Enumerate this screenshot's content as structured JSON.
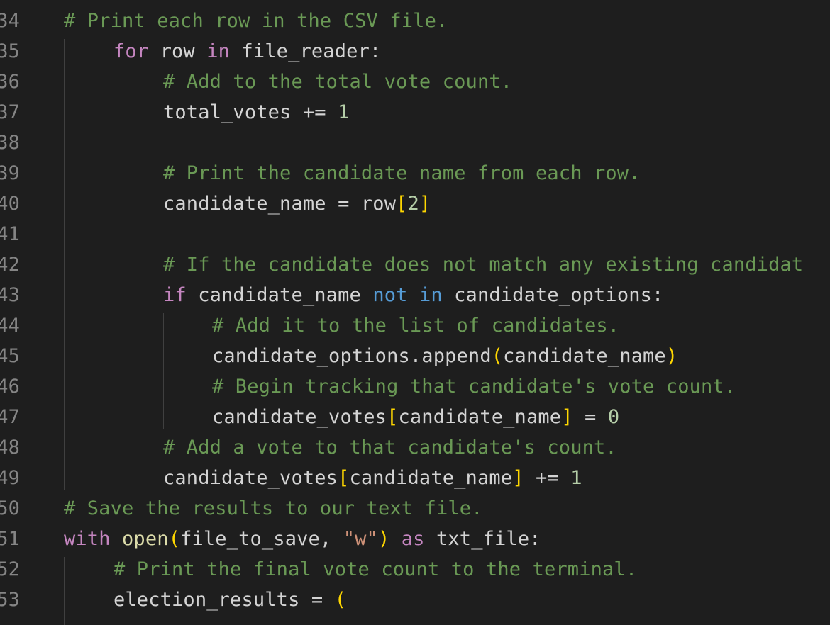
{
  "editor": {
    "language": "python",
    "theme_colors": {
      "background": "#1e1e1e",
      "line_number": "#858585",
      "keyword": "#c586c0",
      "operator_keyword": "#569cd6",
      "comment": "#6a9955",
      "number": "#b5cea8",
      "string": "#ce9178",
      "function": "#dcdcaa",
      "bracket": "#ffd700",
      "identifier": "#d4d4d4"
    },
    "lines": [
      {
        "number": "34",
        "indent": 1,
        "tokens": [
          {
            "t": "cm",
            "v": "# Print each row in the CSV file."
          }
        ]
      },
      {
        "number": "35",
        "indent": 2,
        "tokens": [
          {
            "t": "kw",
            "v": "for"
          },
          {
            "t": "id",
            "v": " row "
          },
          {
            "t": "kw",
            "v": "in"
          },
          {
            "t": "id",
            "v": " file_reader:"
          }
        ]
      },
      {
        "number": "36",
        "indent": 3,
        "tokens": [
          {
            "t": "cm",
            "v": "# Add to the total vote count."
          }
        ]
      },
      {
        "number": "37",
        "indent": 3,
        "tokens": [
          {
            "t": "id",
            "v": "total_votes += "
          },
          {
            "t": "num",
            "v": "1"
          }
        ]
      },
      {
        "number": "38",
        "indent": 3,
        "tokens": []
      },
      {
        "number": "39",
        "indent": 3,
        "tokens": [
          {
            "t": "cm",
            "v": "# Print the candidate name from each row."
          }
        ]
      },
      {
        "number": "40",
        "indent": 3,
        "tokens": [
          {
            "t": "id",
            "v": "candidate_name = row"
          },
          {
            "t": "br",
            "v": "["
          },
          {
            "t": "num",
            "v": "2"
          },
          {
            "t": "br",
            "v": "]"
          }
        ]
      },
      {
        "number": "41",
        "indent": 3,
        "tokens": []
      },
      {
        "number": "42",
        "indent": 3,
        "tokens": [
          {
            "t": "cm",
            "v": "# If the candidate does not match any existing candidat"
          }
        ]
      },
      {
        "number": "43",
        "indent": 3,
        "tokens": [
          {
            "t": "kw",
            "v": "if"
          },
          {
            "t": "id",
            "v": " candidate_name "
          },
          {
            "t": "op",
            "v": "not"
          },
          {
            "t": "id",
            "v": " "
          },
          {
            "t": "op",
            "v": "in"
          },
          {
            "t": "id",
            "v": " candidate_options:"
          }
        ]
      },
      {
        "number": "44",
        "indent": 4,
        "tokens": [
          {
            "t": "cm",
            "v": "# Add it to the list of candidates."
          }
        ]
      },
      {
        "number": "45",
        "indent": 4,
        "tokens": [
          {
            "t": "id",
            "v": "candidate_options.append"
          },
          {
            "t": "br",
            "v": "("
          },
          {
            "t": "id",
            "v": "candidate_name"
          },
          {
            "t": "br",
            "v": ")"
          }
        ]
      },
      {
        "number": "46",
        "indent": 4,
        "tokens": [
          {
            "t": "cm",
            "v": "# Begin tracking that candidate's vote count."
          }
        ]
      },
      {
        "number": "47",
        "indent": 4,
        "tokens": [
          {
            "t": "id",
            "v": "candidate_votes"
          },
          {
            "t": "br",
            "v": "["
          },
          {
            "t": "id",
            "v": "candidate_name"
          },
          {
            "t": "br",
            "v": "]"
          },
          {
            "t": "id",
            "v": " = "
          },
          {
            "t": "num",
            "v": "0"
          }
        ]
      },
      {
        "number": "48",
        "indent": 3,
        "tokens": [
          {
            "t": "cm",
            "v": "# Add a vote to that candidate's count."
          }
        ]
      },
      {
        "number": "49",
        "indent": 3,
        "tokens": [
          {
            "t": "id",
            "v": "candidate_votes"
          },
          {
            "t": "br",
            "v": "["
          },
          {
            "t": "id",
            "v": "candidate_name"
          },
          {
            "t": "br",
            "v": "]"
          },
          {
            "t": "id",
            "v": " += "
          },
          {
            "t": "num",
            "v": "1"
          }
        ]
      },
      {
        "number": "50",
        "indent": 1,
        "tokens": [
          {
            "t": "cm",
            "v": "# Save the results to our text file."
          }
        ]
      },
      {
        "number": "51",
        "indent": 1,
        "tokens": [
          {
            "t": "kw",
            "v": "with"
          },
          {
            "t": "id",
            "v": " "
          },
          {
            "t": "fn",
            "v": "open"
          },
          {
            "t": "br",
            "v": "("
          },
          {
            "t": "id",
            "v": "file_to_save, "
          },
          {
            "t": "str",
            "v": "\"w\""
          },
          {
            "t": "br",
            "v": ")"
          },
          {
            "t": "id",
            "v": " "
          },
          {
            "t": "kw",
            "v": "as"
          },
          {
            "t": "id",
            "v": " txt_file:"
          }
        ]
      },
      {
        "number": "52",
        "indent": 2,
        "tokens": [
          {
            "t": "cm",
            "v": "# Print the final vote count to the terminal."
          }
        ]
      },
      {
        "number": "53",
        "indent": 2,
        "tokens": [
          {
            "t": "id",
            "v": "election_results = "
          },
          {
            "t": "br",
            "v": "("
          }
        ]
      }
    ]
  }
}
